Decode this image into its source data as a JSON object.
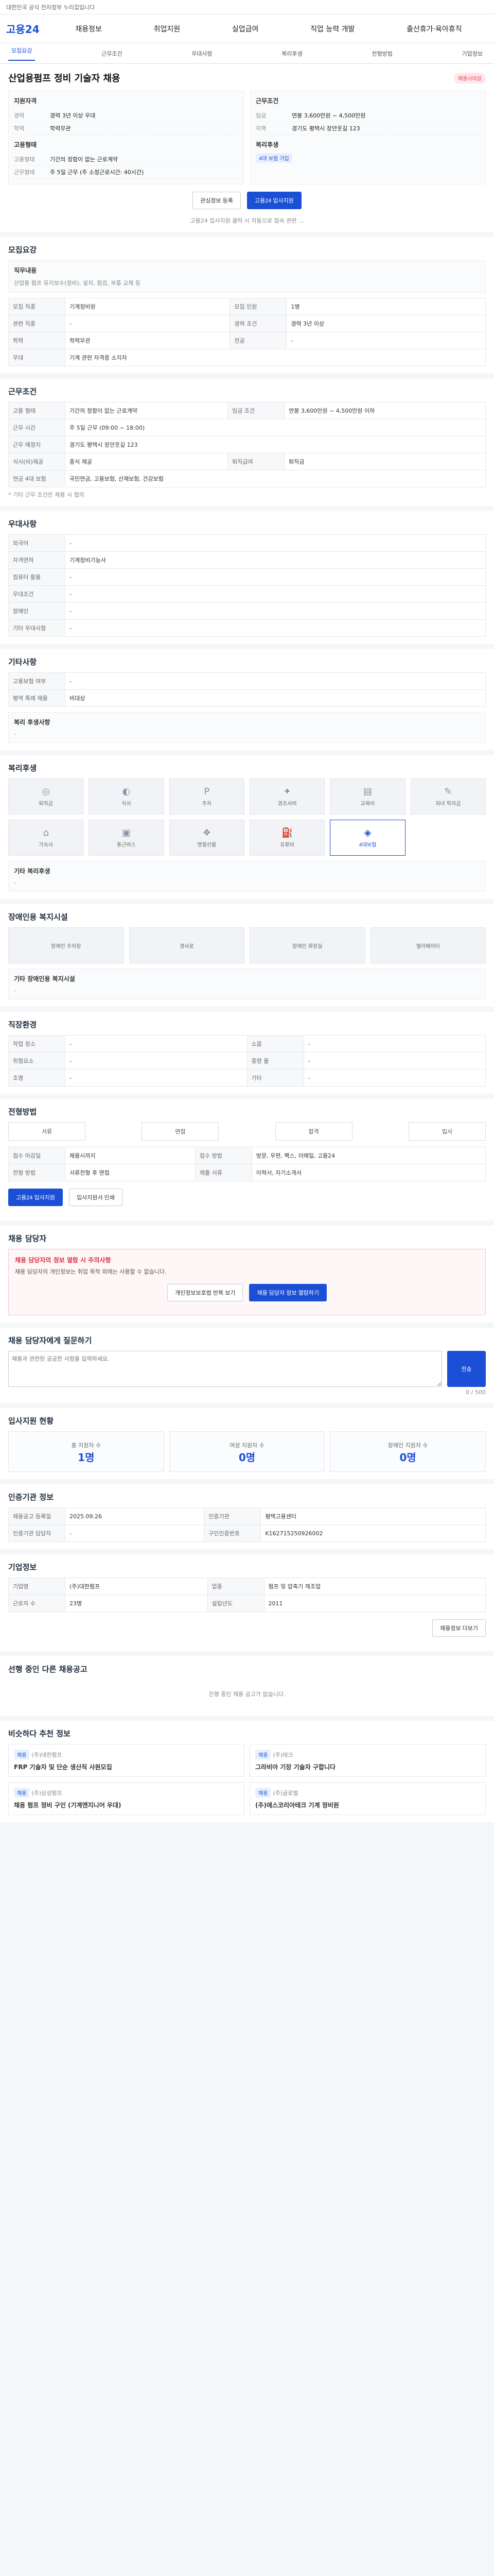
{
  "topbar": {
    "text": "대한민국 공식 전자정부 누리집입니다"
  },
  "header": {
    "logo": "고용24",
    "nav": [
      "채용정보",
      "취업지원",
      "실업급여",
      "직업 능력 개발",
      "출산휴가·육아휴직"
    ]
  },
  "tabs": [
    "모집요강",
    "근무조건",
    "우대사항",
    "복리후생",
    "전형방법",
    "기업정보"
  ],
  "hero": {
    "company": "",
    "title": "산업용펌프 정비 기술자 채용",
    "badge": "채용시마감",
    "left_title": "지원자격",
    "left_kv": [
      {
        "k": "경력",
        "v": "경력 3년 이상 우대"
      },
      {
        "k": "학력",
        "v": "학력무관"
      }
    ],
    "left_title2": "고용형태",
    "left_kv2": [
      {
        "k": "고용형태",
        "v": "기간의 정함이 없는 근로계약"
      },
      {
        "k": "근무형태",
        "v": "주 5일 근무 (주 소정근로시간: 40시간)"
      }
    ],
    "right_title": "근무조건",
    "right_kv": [
      {
        "k": "임금",
        "v": "연봉 3,600만원 ~ 4,500만원"
      },
      {
        "k": "지역",
        "v": "경기도 평택시 장안웃길 123"
      }
    ],
    "right_title2": "복리후생",
    "right_tag": "4대 보험 가입"
  },
  "buttons": {
    "save": "관심정보 등록",
    "apply": "고용24 입사지원"
  },
  "note1": "고용24 입사지원 클릭 시 자동으로 접속 관련 ...",
  "recruit": {
    "title": "모집요강",
    "job_title": "직무내용",
    "job_desc": "산업용 펌프 유지보수(정비), 설치, 점검, 부품 교체 등",
    "rows": [
      {
        "k": "모집 직종",
        "v": "기계정비원"
      },
      {
        "k": "모집 인원",
        "v": "1명"
      },
      {
        "k": "관련 직종",
        "v": "-"
      },
      {
        "k": "경력 조건",
        "v": "경력 3년 이상"
      },
      {
        "k": "학력",
        "v": "학력무관"
      },
      {
        "k": "전공",
        "v": "-"
      }
    ],
    "tag_label": "우대",
    "tag_text": "기계 관련 자격증 소지자"
  },
  "work": {
    "title": "근무조건",
    "rows": [
      {
        "k": "고용 형태",
        "v": "기간의 정함이 없는 근로계약"
      },
      {
        "k": "임금 조건",
        "v": "연봉 3,600만원 ~ 4,500만원 이하"
      },
      {
        "k": "근무 시간",
        "v": "주 5일 근무 (09:00 ~ 18:00)"
      },
      {
        "k": "근무 예정지",
        "v": "경기도 평택시 장안웃길 123"
      },
      {
        "k": "식사(비)제공",
        "v": "중식 제공"
      },
      {
        "k": "퇴직급여",
        "v": "퇴직금"
      },
      {
        "k": "연금 4대 보험",
        "v": "국민연금, 고용보험, 산재보험, 건강보험"
      }
    ],
    "note": "* 기타 근무 조건은 채용 시 협의"
  },
  "prefer": {
    "title": "우대사항",
    "rows": [
      {
        "k": "외국어",
        "v": "-"
      },
      {
        "k": "자격면허",
        "v": "기계정비기능사"
      },
      {
        "k": "컴퓨터 활용",
        "v": "-"
      },
      {
        "k": "우대조건",
        "v": "-"
      },
      {
        "k": "장애인",
        "v": "-"
      },
      {
        "k": "기타 우대사항",
        "v": "-"
      }
    ]
  },
  "etc": {
    "title": "기타사항",
    "rows": [
      {
        "k": "고용보험 여부",
        "v": "-"
      },
      {
        "k": "병역 특례 채용",
        "v": "비대상"
      }
    ],
    "sub": "복리 후생사항",
    "subv": "-"
  },
  "welfare": {
    "title": "복리후생",
    "tiles": [
      "퇴직금",
      "식사",
      "주차",
      "경조사비",
      "교육비",
      "자녀 학자금",
      "기숙사",
      "통근버스",
      "명절선물",
      "유류비",
      "4대보험"
    ],
    "note_title": "기타 복리후생",
    "note": "-"
  },
  "disabled": {
    "title": "장애인용 복지시설",
    "tiles": [
      "장애인 주차장",
      "경사로",
      "장애인 화장실",
      "엘리베이터"
    ],
    "note_title": "기타 장애인용 복지시설",
    "note": "-"
  },
  "workplace": {
    "title": "직장환경",
    "rows": [
      {
        "k": "작업 장소",
        "v": "-"
      },
      {
        "k": "소음",
        "v": "-"
      },
      {
        "k": "위험요소",
        "v": "-"
      },
      {
        "k": "중량 물",
        "v": "-"
      },
      {
        "k": "조명",
        "v": "-"
      },
      {
        "k": "기타",
        "v": "-"
      }
    ]
  },
  "process": {
    "title": "전형방법",
    "steps": [
      "서류",
      "면접",
      "합격",
      "입사"
    ],
    "rows": [
      {
        "k": "접수 마감일",
        "v": "채용시까지"
      },
      {
        "k": "접수 방법",
        "v": "방문, 우편, 팩스, 이메일, 고용24"
      },
      {
        "k": "전형 방법",
        "v": "서류전형 후 면접"
      },
      {
        "k": "제출 서류",
        "v": "이력서, 자기소개서"
      }
    ],
    "btn_apply": "고용24 입사지원",
    "btn_print": "입사지원서 인쇄"
  },
  "manager": {
    "title": "채용 담당자",
    "alert_title": "채용 담당자의 정보 열람 시 주의사항",
    "alert_text": "채용 담당자의 개인정보는 취업 목적 외에는 사용할 수 없습니다.",
    "btn1": "개인정보보호법 반복 보기",
    "btn2": "채용 담당자 정보 열람하기"
  },
  "ask": {
    "title": "채용 담당자에게 질문하기",
    "placeholder": "채용과 관련된 궁금한 사항을 입력하세요.",
    "btn": "전송",
    "count": "0 / 500"
  },
  "stats": {
    "title": "입사지원 현황",
    "items": [
      {
        "n": "1명",
        "l": "총 지원자 수"
      },
      {
        "n": "0명",
        "l": "여성 지원자 수"
      },
      {
        "n": "0명",
        "l": "장애인 지원자 수"
      }
    ]
  },
  "auth": {
    "title": "인증기관 정보",
    "rows": [
      {
        "k": "채용공고 등록일",
        "v": "2025.09.26"
      },
      {
        "k": "인증기관",
        "v": "평택고용센터"
      },
      {
        "k": "인증기관 담당자",
        "v": "-"
      },
      {
        "k": "구인인증번호",
        "v": "K162715250926002"
      }
    ]
  },
  "company": {
    "title": "기업정보",
    "rows": [
      {
        "k": "기업명",
        "v": "(주)대한펌프"
      },
      {
        "k": "업종",
        "v": "펌프 및 압축기 제조업"
      },
      {
        "k": "근로자 수",
        "v": "23명"
      },
      {
        "k": "설립년도",
        "v": "2011"
      }
    ],
    "btn": "채용정보 더보기"
  },
  "similar": {
    "title": "선행 중인 다른 채용공고",
    "empty": "진행 중인 채용 공고가 없습니다."
  },
  "recommend": {
    "title": "비슷하다 추천 정보",
    "cards": [
      {
        "tag": "채용",
        "co": "(주)대한펌프",
        "t": "FRP 기술자 및 단순 생산직 사원모집"
      },
      {
        "tag": "채용",
        "co": "(주)테크",
        "t": "그라비아 기장 기술자 구합니다"
      },
      {
        "tag": "채용",
        "co": "(주)삼성펌프",
        "t": "채용 펌프 정비 구인 (기계엔지니어 우대)"
      },
      {
        "tag": "채용",
        "co": "(주)글로벌",
        "t": "(주)에스코리아테크 기계 정비원"
      }
    ]
  }
}
